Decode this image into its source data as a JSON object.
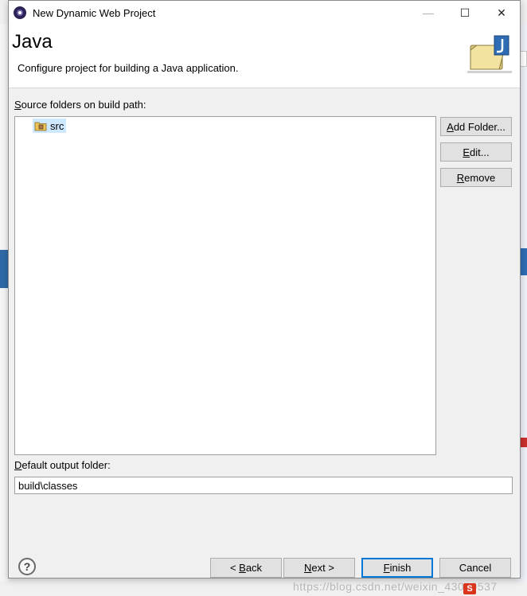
{
  "window": {
    "title": "New Dynamic Web Project",
    "minimize_glyph": "—",
    "maximize_glyph": "☐",
    "close_glyph": "✕"
  },
  "banner": {
    "heading": "Java",
    "description": "Configure project for building a Java application."
  },
  "source_section": {
    "label_prefix": "S",
    "label_rest": "ource folders on build path:",
    "folders": [
      {
        "name": "src",
        "selected": true,
        "icon": "package-folder-icon"
      }
    ]
  },
  "side_buttons": {
    "add_folder": {
      "mnemonic": "A",
      "rest": "dd Folder..."
    },
    "edit": {
      "mnemonic": "E",
      "rest": "dit..."
    },
    "remove": {
      "mnemonic": "R",
      "rest": "emove"
    }
  },
  "output_section": {
    "label_prefix": "D",
    "label_rest": "efault output folder:",
    "value": "build\\classes"
  },
  "footer": {
    "help_glyph": "?",
    "back": {
      "pre": "< ",
      "mnemonic": "B",
      "rest": "ack"
    },
    "next": {
      "mnemonic": "N",
      "rest": "ext >"
    },
    "finish": {
      "mnemonic": "F",
      "rest": "inish"
    },
    "cancel": "Cancel"
  },
  "watermark": {
    "text": "https://blog.csdn.net/weixin_43019537",
    "logo": "S"
  },
  "colors": {
    "selection": "#cde8ff",
    "default_button_border": "#0078d7",
    "button_face": "#e1e1e1"
  }
}
